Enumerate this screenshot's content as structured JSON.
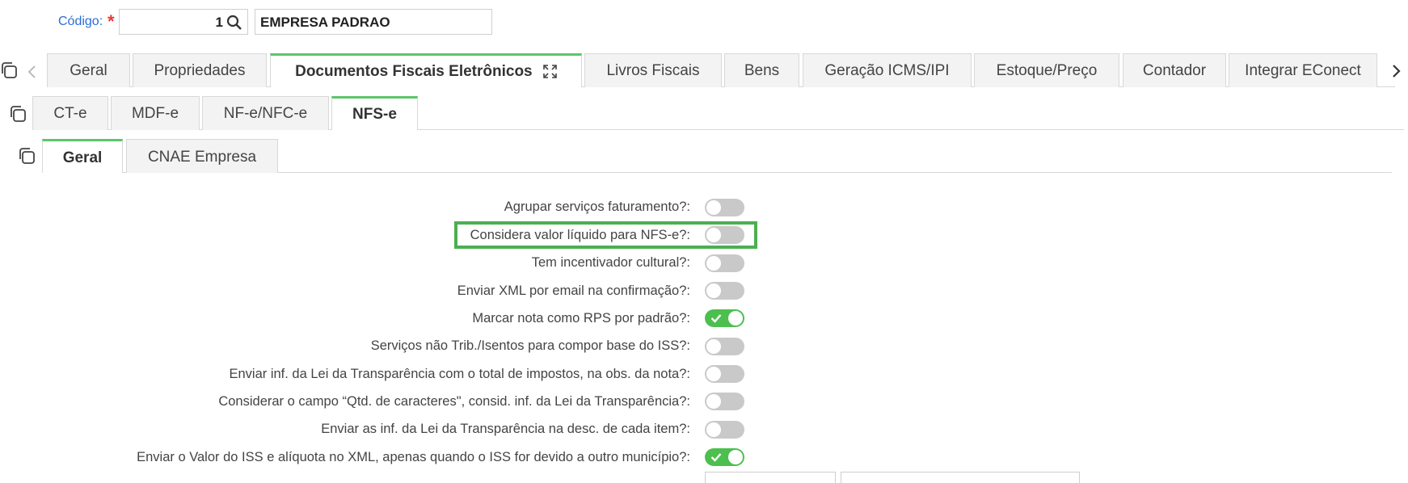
{
  "header": {
    "code_label": "Código:",
    "required_mark": "*",
    "code_value": "1",
    "company_name": "EMPRESA PADRAO"
  },
  "main_tabs": [
    {
      "label": "Geral",
      "active": false
    },
    {
      "label": "Propriedades",
      "active": false
    },
    {
      "label": "Documentos Fiscais Eletrônicos",
      "active": true
    },
    {
      "label": "Livros Fiscais",
      "active": false
    },
    {
      "label": "Bens",
      "active": false
    },
    {
      "label": "Geração ICMS/IPI",
      "active": false
    },
    {
      "label": "Estoque/Preço",
      "active": false
    },
    {
      "label": "Contador",
      "active": false
    },
    {
      "label": "Integrar EConect",
      "active": false
    }
  ],
  "doc_tabs": [
    {
      "label": "CT-e",
      "active": false
    },
    {
      "label": "MDF-e",
      "active": false
    },
    {
      "label": "NF-e/NFC-e",
      "active": false
    },
    {
      "label": "NFS-e",
      "active": true
    }
  ],
  "nfse_tabs": [
    {
      "label": "Geral",
      "active": true
    },
    {
      "label": "CNAE Empresa",
      "active": false
    }
  ],
  "options": [
    {
      "label": "Agrupar serviços faturamento?:",
      "on": false
    },
    {
      "label": "Considera valor líquido para NFS-e?:",
      "on": false,
      "highlighted": true
    },
    {
      "label": "Tem incentivador cultural?:",
      "on": false
    },
    {
      "label": "Enviar XML por email na confirmação?:",
      "on": false
    },
    {
      "label": "Marcar nota como RPS por padrão?:",
      "on": true
    },
    {
      "label": "Serviços não Trib./Isentos para compor base do ISS?:",
      "on": false
    },
    {
      "label": "Enviar inf. da Lei da Transparência com o total de impostos, na obs. da nota?:",
      "on": false
    },
    {
      "label": "Considerar o campo “Qtd. de caracteres\", consid. inf. da Lei da Transparência?:",
      "on": false
    },
    {
      "label": "Enviar as inf. da Lei da Transparência na desc. de cada item?:",
      "on": false
    },
    {
      "label": "Enviar o Valor do ISS e alíquota no XML, apenas quando o ISS for devido a outro município?:",
      "on": true
    }
  ],
  "colors": {
    "accent_green": "#5cc56a",
    "toggle_on": "#4cbf4f",
    "toggle_off": "#c9c9c9",
    "link_blue": "#2a6fd6",
    "required_red": "#e53935",
    "highlight_box": "#4caf50"
  },
  "icons": {
    "search": "search-icon",
    "copy": "copy-icon",
    "expand": "expand-icon",
    "prev": "chevron-left-icon",
    "next": "chevron-right-icon",
    "check": "check-icon"
  }
}
